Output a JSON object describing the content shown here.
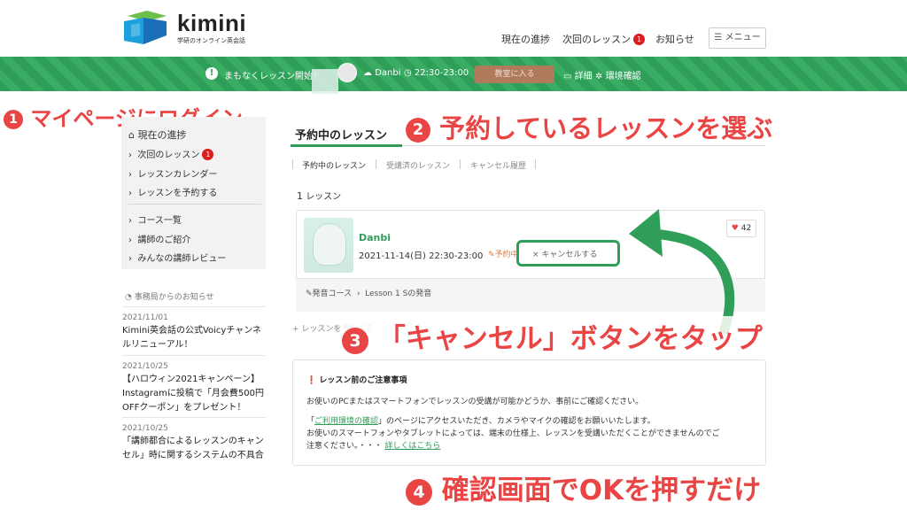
{
  "header": {
    "brand_name": "kimini",
    "brand_tagline": "学研のオンライン英会話",
    "nav": {
      "progress": "現在の進捗",
      "next_lesson": "次回のレッスン",
      "next_lesson_badge": "1",
      "news": "お知らせ",
      "menu": "メニュー"
    }
  },
  "greenbar": {
    "alert_text": "まもなくレッスン開始！",
    "tutor": "Danbi",
    "time": "22:30-23:00",
    "enter_button": "教室に入る",
    "details": "詳細",
    "env_check": "環境確認"
  },
  "annotations": {
    "step1": {
      "num": "1",
      "text": "マイページにログイン"
    },
    "step2": {
      "num": "2",
      "text": "予約しているレッスンを選ぶ"
    },
    "step3": {
      "num": "3",
      "text": "「キャンセル」ボタンをタップ"
    },
    "step4": {
      "num": "4",
      "text": "確認画面でOKを押すだけ"
    }
  },
  "sidebar": {
    "title": "現在の進捗",
    "items": [
      {
        "label": "次回のレッスン",
        "badge": "1"
      },
      {
        "label": "レッスンカレンダー"
      },
      {
        "label": "レッスンを予約する"
      },
      {
        "label": "コース一覧"
      },
      {
        "label": "講師のご紹介"
      },
      {
        "label": "みんなの講師レビュー"
      }
    ]
  },
  "news": {
    "heading": "事務局からのお知らせ",
    "items": [
      {
        "date": "2021/11/01",
        "line1": "Kimini英会話の公式Voicyチャンネ",
        "line2": "ルリニューアル！",
        "line3": ""
      },
      {
        "date": "2021/10/25",
        "line1": "【ハロウィン2021キャンペーン】",
        "line2": "Instagramに投稿で「月会費500円",
        "line3": "OFFクーポン」をプレゼント！"
      },
      {
        "date": "2021/10/25",
        "line1": "「講師都合によるレッスンのキャン",
        "line2": "セル」時に関するシステムの不具合",
        "line3": ""
      }
    ]
  },
  "main": {
    "title": "予約中のレッスン",
    "tabs": [
      "予約中のレッスン",
      "受講済のレッスン",
      "キャンセル履歴"
    ],
    "count_num": "1",
    "count_unit": "レッスン",
    "lesson": {
      "tutor": "Danbi",
      "datetime": "2021-11-14(日) 22:30-23:00",
      "status": "予約中",
      "cancel": "× キャンセルする",
      "likes": "42",
      "course": "発音コース",
      "unit": "Lesson 1 Sの発音"
    },
    "reserve_more": "+ レッスンを予約する"
  },
  "notice": {
    "title": "レッスン前のご注意事項",
    "line1": "お使いのPCまたはスマートフォンでレッスンの受講が可能かどうか、事前にご確認ください。",
    "line2_pre": "「",
    "line2_link": "ご利用環境の確認",
    "line2_post": "」のページにアクセスいただき、カメラやマイクの確認をお願いいたします。",
    "line3": "お使いのスマートフォンやタブレットによっては、端末の仕様上、レッスンを受講いただくことができませんのでご",
    "line4_pre": "注意ください。・・・",
    "line4_link": "詳しくはこちら"
  },
  "colors": {
    "accent_green": "#2f9e58",
    "annotation_red": "#e94545",
    "badge_red": "#d9201f"
  }
}
